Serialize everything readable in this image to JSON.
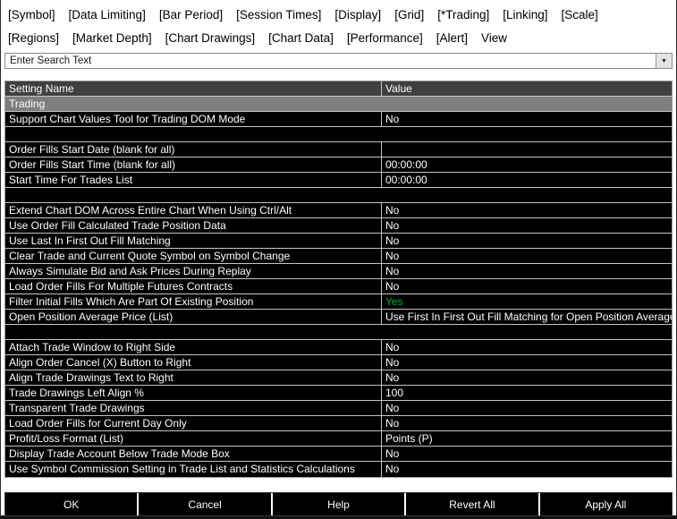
{
  "menu": {
    "row1": [
      "[Symbol]",
      "[Data Limiting]",
      "[Bar Period]",
      "[Session Times]",
      "[Display]",
      "[Grid]",
      "[*Trading]",
      "[Linking]",
      "[Scale]"
    ],
    "row2": [
      "[Regions]",
      "[Market Depth]",
      "[Chart Drawings]",
      "[Chart Data]",
      "[Performance]",
      "[Alert]",
      "View"
    ]
  },
  "search": {
    "placeholder": "Enter Search Text"
  },
  "colors": {
    "value_green": "#00b32c",
    "section_gray": "#7e7e7e",
    "header_gray": "#404040"
  },
  "table": {
    "headers": [
      "Setting Name",
      "Value"
    ],
    "rows": [
      {
        "type": "section",
        "name": "Trading"
      },
      {
        "type": "data",
        "name": "Support Chart Values Tool for Trading DOM Mode",
        "value": "No"
      },
      {
        "type": "spacer"
      },
      {
        "type": "data",
        "name": "Order Fills Start Date (blank for all)",
        "value": ""
      },
      {
        "type": "data",
        "name": "Order Fills Start Time (blank for all)",
        "value": "00:00:00"
      },
      {
        "type": "data",
        "name": "Start Time For Trades List",
        "value": "00:00:00"
      },
      {
        "type": "spacer"
      },
      {
        "type": "data",
        "name": "Extend Chart DOM Across Entire Chart When Using Ctrl/Alt",
        "value": "No"
      },
      {
        "type": "data",
        "name": "Use Order Fill Calculated Trade Position Data",
        "value": "No"
      },
      {
        "type": "data",
        "name": "Use Last In First Out Fill Matching",
        "value": "No"
      },
      {
        "type": "data",
        "name": "Clear Trade and Current Quote Symbol on Symbol Change",
        "value": "No"
      },
      {
        "type": "data",
        "name": "Always Simulate Bid and Ask Prices During Replay",
        "value": "No"
      },
      {
        "type": "data",
        "name": "Load Order Fills For Multiple Futures Contracts",
        "value": "No"
      },
      {
        "type": "data",
        "name": "Filter Initial Fills Which Are Part Of Existing Position",
        "value": "Yes",
        "value_color": "#00b32c"
      },
      {
        "type": "data",
        "name": "Open Position Average Price (List)",
        "value": "Use First In First Out Fill Matching for Open Position Average Price"
      },
      {
        "type": "spacer"
      },
      {
        "type": "data",
        "name": "Attach Trade Window to Right Side",
        "value": "No"
      },
      {
        "type": "data",
        "name": "Align Order Cancel (X) Button to Right",
        "value": "No"
      },
      {
        "type": "data",
        "name": "Align Trade Drawings Text to Right",
        "value": "No"
      },
      {
        "type": "data",
        "name": "Trade Drawings Left Align %",
        "value": "100"
      },
      {
        "type": "data",
        "name": "Transparent Trade Drawings",
        "value": "No"
      },
      {
        "type": "data",
        "name": "Load Order Fills for Current Day Only",
        "value": "No"
      },
      {
        "type": "data",
        "name": "Profit/Loss Format (List)",
        "value": "Points (P)"
      },
      {
        "type": "data",
        "name": "Display Trade Account Below Trade Mode Box",
        "value": "No"
      },
      {
        "type": "data",
        "name": "Use Symbol Commission Setting in Trade List and Statistics Calculations",
        "value": "No"
      }
    ]
  },
  "buttons": [
    "OK",
    "Cancel",
    "Help",
    "Revert All",
    "Apply All"
  ]
}
